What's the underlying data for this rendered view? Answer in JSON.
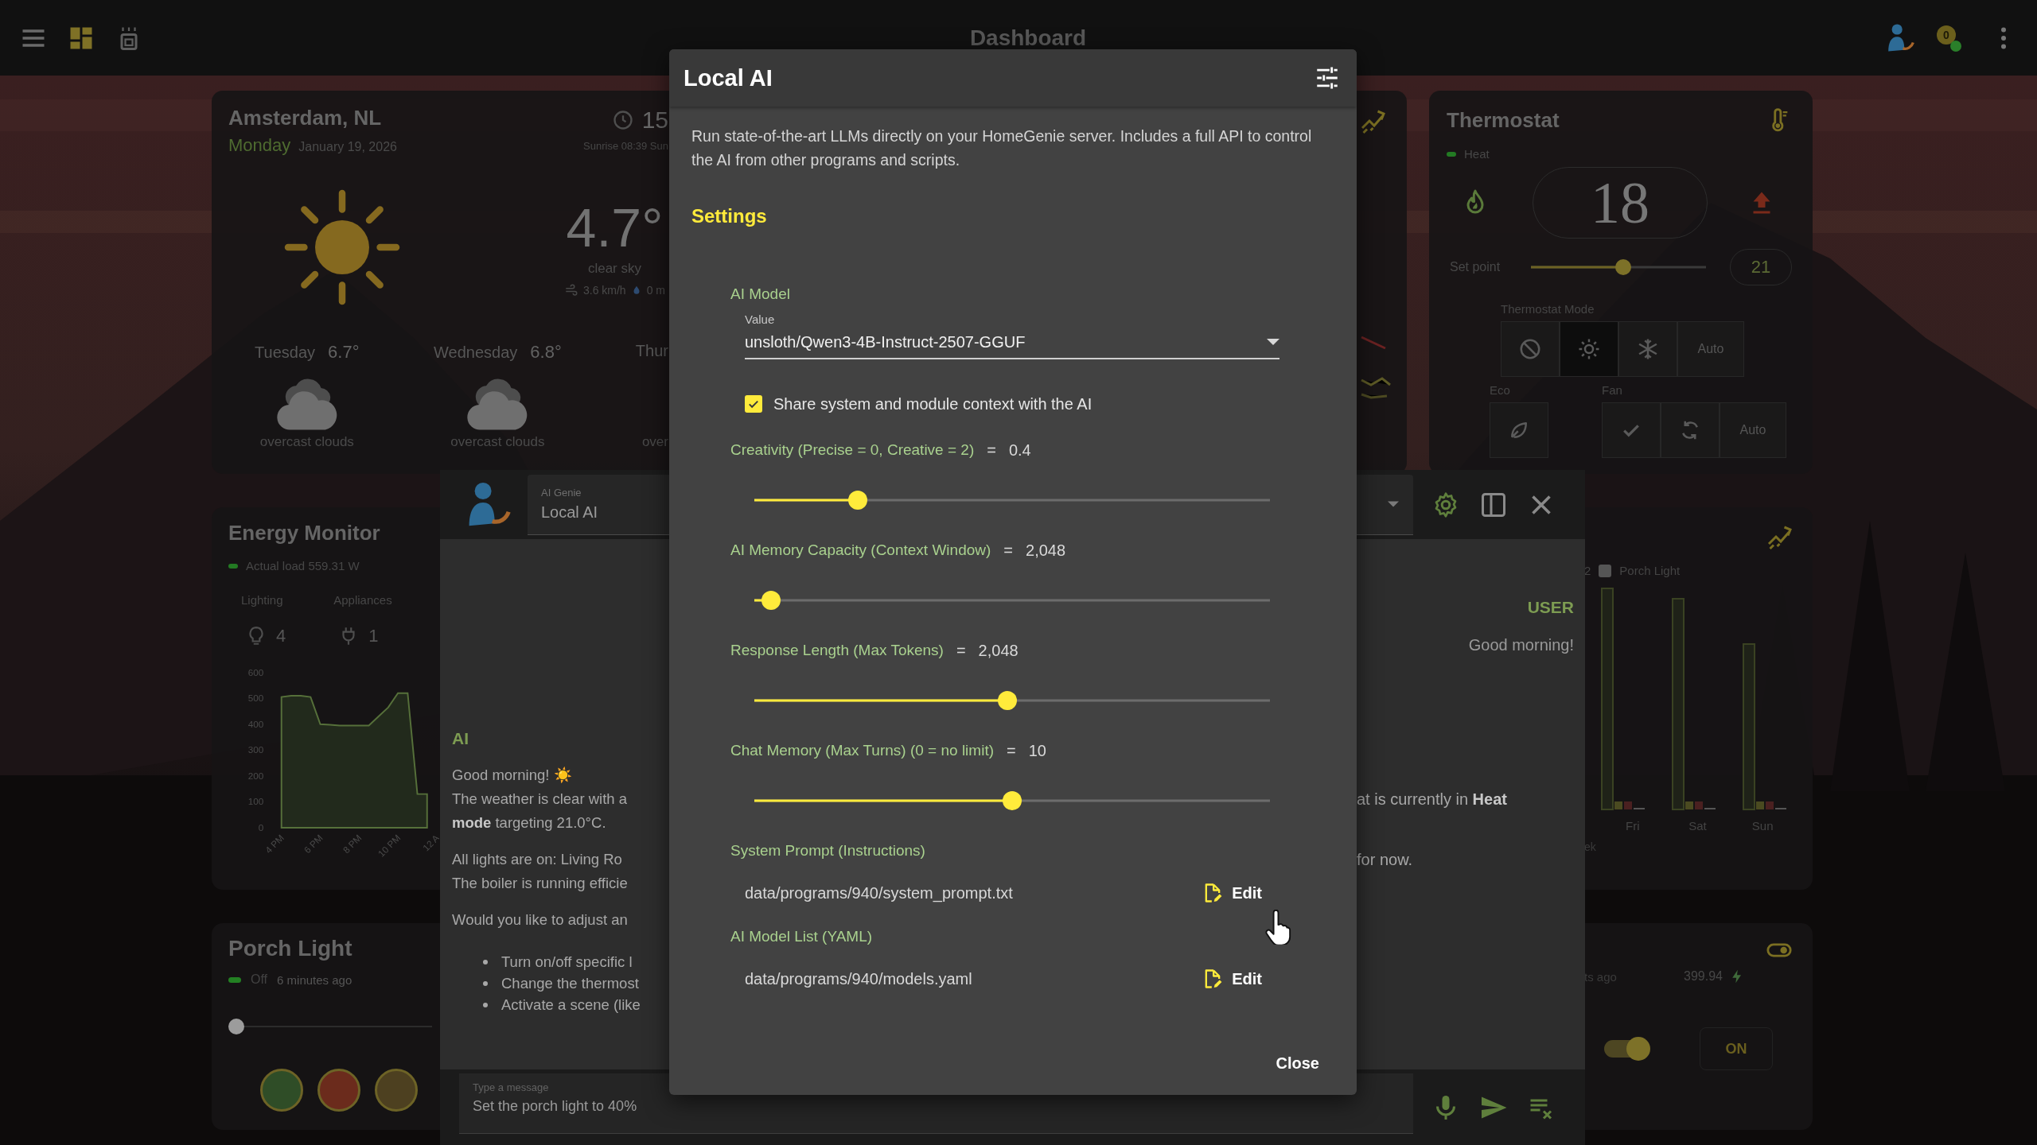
{
  "top_bar": {
    "title": "Dashboard",
    "notification_count": "0"
  },
  "weather": {
    "city": "Amsterdam, NL",
    "day": "Monday",
    "date": "January 19, 2026",
    "time": "15",
    "sun_times": "Sunrise 08:39 Sun",
    "temperature": "4.7°",
    "condition": "clear sky",
    "wind": "3.6 km/h",
    "rain": "0 m",
    "forecast": [
      {
        "day": "Tuesday",
        "temperature": "6.7°",
        "condition": "overcast clouds"
      },
      {
        "day": "Wednesday",
        "temperature": "6.8°",
        "condition": "overcast clouds"
      },
      {
        "day": "Thur",
        "condition": "over"
      }
    ]
  },
  "thermostat": {
    "title": "Thermostat",
    "status": "Heat",
    "temperature": "18",
    "setpoint": {
      "label": "Set point",
      "level": 0.53,
      "value": "21"
    },
    "mode_label": "Thermostat Mode",
    "modes": [
      {
        "kind": "off",
        "selected": false
      },
      {
        "kind": "heat",
        "selected": true
      },
      {
        "kind": "cool",
        "selected": false
      },
      {
        "kind": "text",
        "label": "Auto",
        "selected": false
      }
    ],
    "eco_label": "Eco",
    "fan_label": "Fan",
    "fan_modes": [
      {
        "kind": "check"
      },
      {
        "kind": "cycle"
      },
      {
        "kind": "text",
        "label": "Auto"
      }
    ]
  },
  "energy": {
    "title": "Energy Monitor",
    "load": "Actual load 559.31 W",
    "lighting_label": "Lighting",
    "lighting_count": "4",
    "appliances_label": "Appliances",
    "appliances_count": "1",
    "chart_data": {
      "type": "area",
      "categories": [
        "4 PM",
        null,
        null,
        null,
        "6 PM",
        null,
        null,
        null,
        "8 PM",
        null,
        null,
        null,
        "10 PM",
        null,
        null,
        null,
        "12 A"
      ],
      "series": [
        {
          "color": "#56703a",
          "values": [
            505,
            510,
            510,
            505,
            400,
            398,
            395,
            395,
            395,
            395,
            430,
            465,
            520,
            520,
            130,
            130,
            null
          ]
        }
      ],
      "ylim": [
        0,
        600
      ],
      "yticks": [
        0,
        100,
        200,
        300,
        400,
        500,
        600
      ]
    }
  },
  "porch_light": {
    "title": "Porch Light",
    "status": "Off",
    "updated": "6 minutes ago",
    "brightness": {
      "level": 0
    },
    "colors": [
      {
        "color": "#2f4d27"
      },
      {
        "color": "#6b2b1c"
      },
      {
        "color": "#4d4020"
      }
    ]
  },
  "usage_chart": {
    "legend_count": "2",
    "legend_label": "Porch Light",
    "days": [
      "Fri",
      "Sat",
      "Sun"
    ],
    "footer": "ek"
  },
  "switch_card": {
    "updated": "ts ago",
    "power": "399.94",
    "switch": {
      "on": true
    },
    "state_button": "ON"
  },
  "chat": {
    "agent_label": "AI Genie",
    "agent": "Local AI",
    "user": {
      "label": "USER",
      "text": "Good morning!"
    },
    "ai": {
      "label": "AI",
      "paragraphs": [
        [
          {
            "left": "Good morning! ☀️"
          },
          {
            "left": "The weather is clear with a",
            "right": "at is currently in **Heat**"
          },
          {
            "left": "**mode** targeting 21.0°C."
          }
        ],
        [
          {
            "left": "All lights are on: Living Ro",
            "right": "for now."
          },
          {
            "left": "The boiler is running efficie"
          }
        ],
        [
          {
            "left": "Would you like to adjust an"
          }
        ]
      ],
      "bullets": [
        "Turn on/off specific l",
        "Change the thermost",
        "Activate a scene (like"
      ]
    },
    "input": {
      "label": "Type a message",
      "value": "Set the porch light to 40%"
    }
  },
  "dialog": {
    "title": "Local AI",
    "description": "Run state-of-the-art LLMs directly on your HomeGenie server. Includes a full API to control the AI from other programs and scripts.",
    "section": "Settings",
    "model": {
      "label": "AI Model",
      "field_label": "Value",
      "value": "unsloth/Qwen3-4B-Instruct-2507-GGUF"
    },
    "share_context": {
      "label": "Share system and module context with the AI",
      "checked": true
    },
    "sliders": [
      {
        "label": "Creativity (Precise = 0, Creative = 2)",
        "sign": "=",
        "value": "0.4",
        "level": 0.2
      },
      {
        "label": "AI Memory Capacity (Context Window)",
        "sign": "=",
        "value": "2,048",
        "level": 0.033
      },
      {
        "label": "Response Length (Max Tokens)",
        "sign": "=",
        "value": "2,048",
        "level": 0.49
      },
      {
        "label": "Chat Memory (Max Turns) (0 = no limit)",
        "sign": "=",
        "value": "10",
        "level": 0.5
      }
    ],
    "files": [
      {
        "label": "System Prompt (Instructions)",
        "path": "data/programs/940/system_prompt.txt",
        "action": "Edit"
      },
      {
        "label": "AI Model List (YAML)",
        "path": "data/programs/940/models.yaml",
        "action": "Edit"
      }
    ],
    "close": "Close"
  }
}
